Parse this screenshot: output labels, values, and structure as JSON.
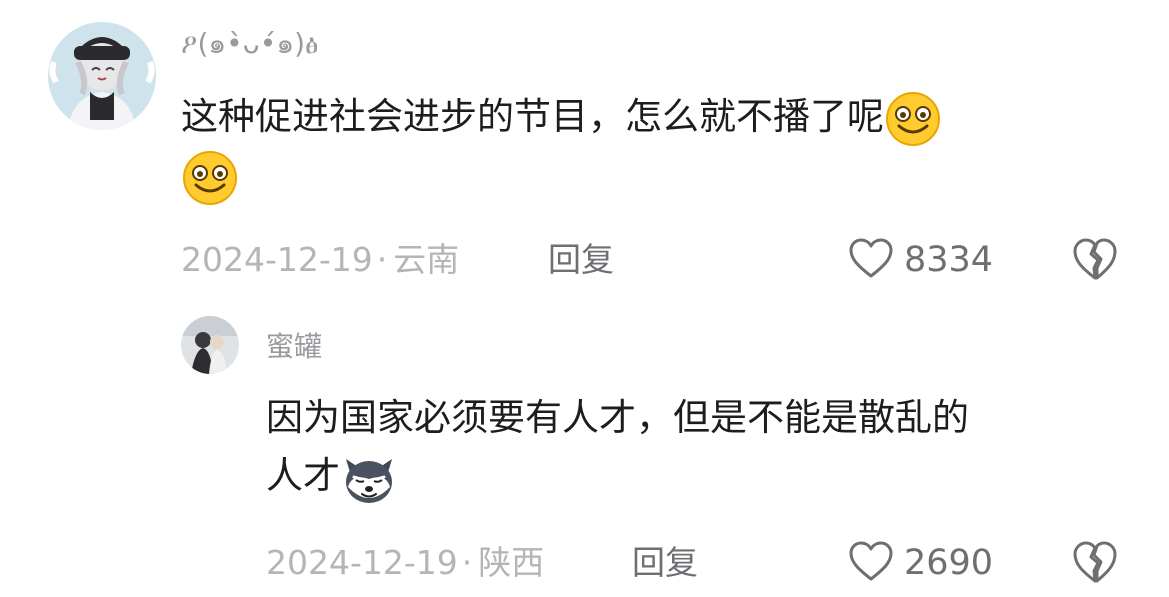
{
  "comments": [
    {
      "username": "ዖ(๑•̀ᴗ•́๑)ፅ",
      "text": "这种促进社会进步的节目，怎么就不播了呢",
      "emojis": [
        "smile-emoji",
        "smile-emoji"
      ],
      "date": "2024-12-19",
      "location": "云南",
      "reply_label": "回复",
      "likes": "8334"
    },
    {
      "username": "蜜罐",
      "text_line1": "因为国家必须要有人才，但是不能是散乱的",
      "text_line2": "人才",
      "emojis": [
        "husky-dog-emoji"
      ],
      "date": "2024-12-19",
      "location": "陕西",
      "reply_label": "回复",
      "likes": "2690"
    }
  ],
  "separator": "·",
  "colors": {
    "text": "#1d1d1f",
    "username": "#9a9a9e",
    "meta": "#b5b5b8",
    "action": "#6e6e73"
  }
}
